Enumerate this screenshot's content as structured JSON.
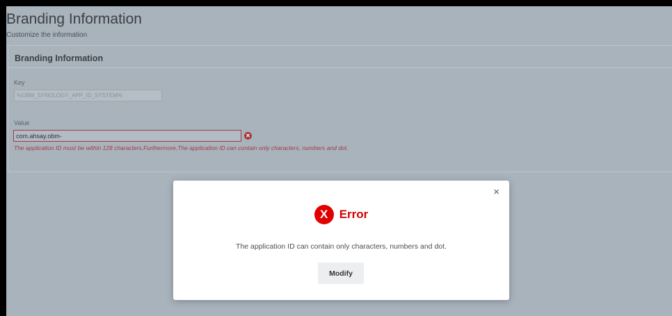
{
  "page": {
    "title": "Branding Information",
    "subtitle": "Customize the information"
  },
  "section": {
    "title": "Branding Information",
    "key_label": "Key",
    "key_value": "%OBM_SYNOLOGY_APP_ID_SYSTEM%",
    "value_label": "Value",
    "value_value": "com.ahsay.obm-",
    "error_text": "The application ID must be within 128 characters.Furthermore,The application ID can contain only characters, numbers and dot."
  },
  "modal": {
    "close_glyph": "×",
    "icon_glyph": "X",
    "title": "Error",
    "message": "The application ID can contain only characters, numbers and dot.",
    "button_label": "Modify"
  },
  "colors": {
    "backdrop": "#a9b3bc",
    "error_red": "#e00000",
    "validation_red": "#a13b44"
  }
}
